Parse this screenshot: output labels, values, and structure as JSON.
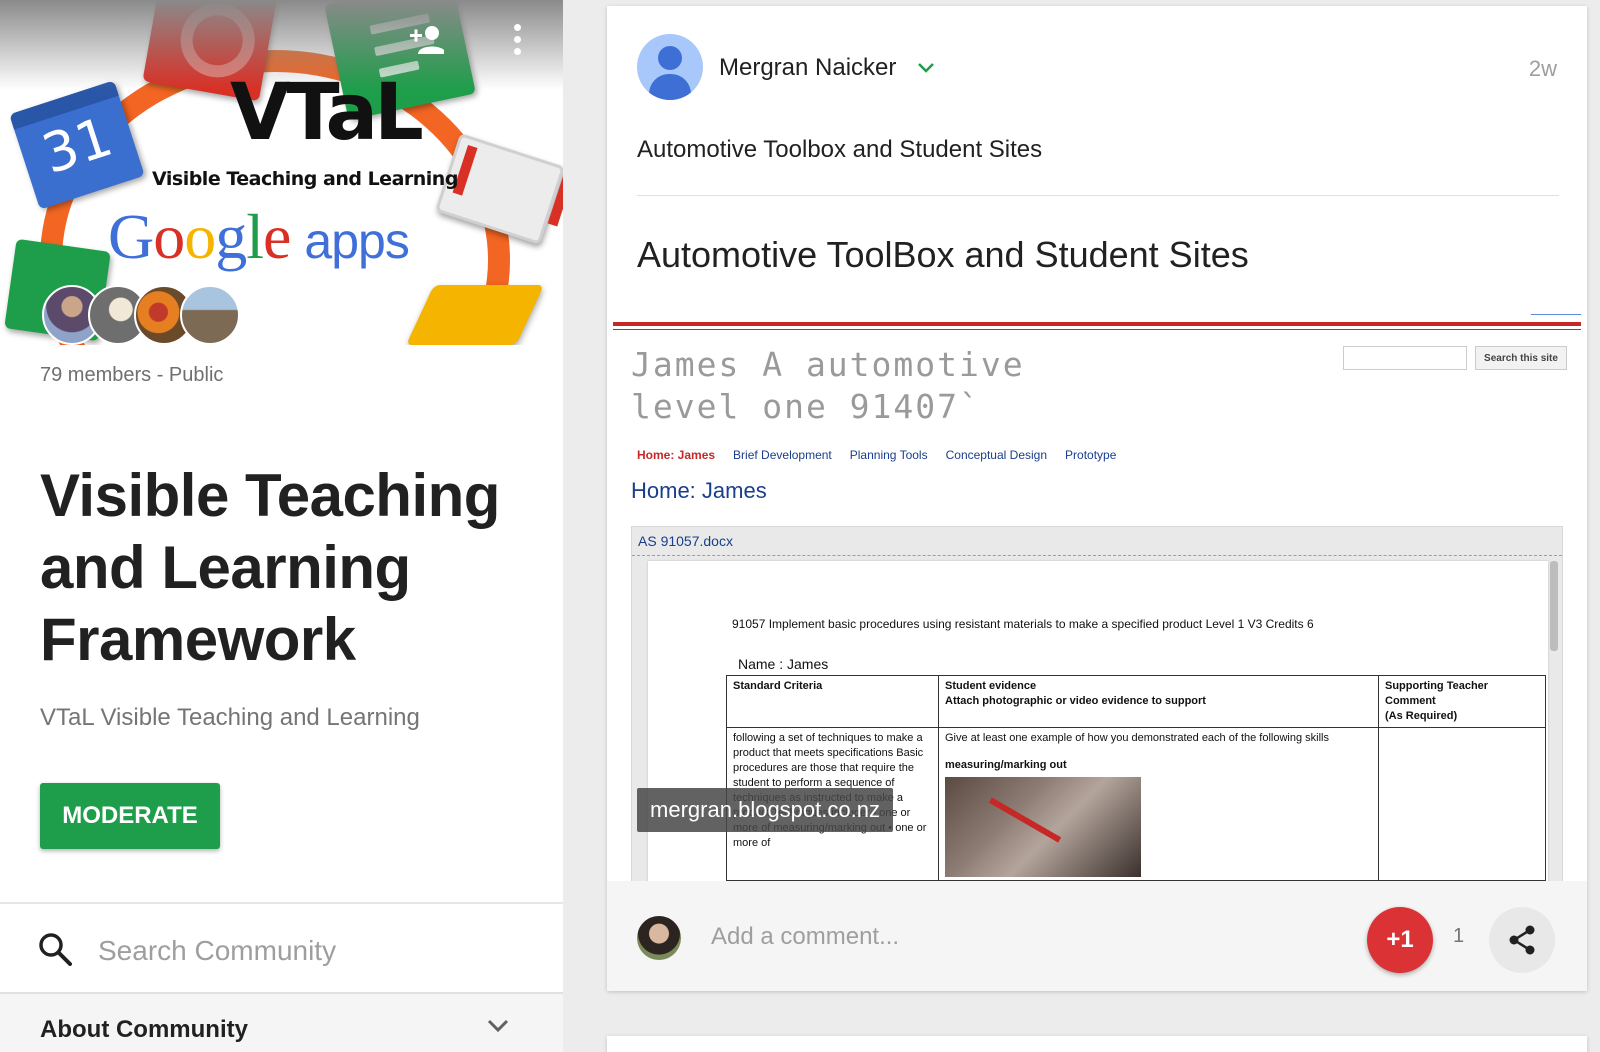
{
  "community": {
    "banner": {
      "logo_text": "VTaL",
      "logo_subtitle": "Visible Teaching and Learning",
      "google_text": "Google",
      "apps_text": "apps",
      "calendar_number": "31"
    },
    "members_text": "79 members - Public",
    "title": "Visible Teaching and Learning Framework",
    "subtitle": "VTaL Visible Teaching and Learning",
    "moderate_label": "MODERATE",
    "search_placeholder": "Search Community",
    "about_label": "About Community"
  },
  "post": {
    "author": "Mergran Naicker",
    "time": "2w",
    "text": "Automotive Toolbox and Student Sites",
    "link_title": "Automotive ToolBox and Student Sites",
    "preview": {
      "site_title_line1": "James A automotive",
      "site_title_line2": "level one 91407`",
      "search_button": "Search this site",
      "nav": [
        "Home: James",
        "Brief Development",
        "Planning Tools",
        "Conceptual Design",
        "Prototype"
      ],
      "heading": "Home: James",
      "doc_name": "AS 91057.docx",
      "doc_line": "91057 Implement basic procedures using resistant materials to make a specified product    Level  1  V3  Credits 6",
      "doc_student": "Name : James",
      "table_headers": [
        "Standard Criteria",
        "Student evidence",
        "Attach photographic or video evidence to support",
        "Supporting Teacher  Comment",
        "(As Required)"
      ],
      "criteria_text": "following a set of techniques to make a product that meets specifications Basic procedures are those that require the student to perform a sequence of techniques as instructed to make a product Techniques include: • one or more of measuring/marking out • one or more of",
      "evidence_intro": "Give at least one example of how you demonstrated each of  the following skills",
      "evidence_item": "measuring/marking out",
      "watermark": "mergran.blogspot.co.nz"
    },
    "comment_placeholder": "Add a comment...",
    "plusone_label": "+1",
    "plusone_count": "1"
  },
  "colors": {
    "moderate": "#1e9e4a",
    "plusone": "#db3236",
    "site_link": "#1a3e8c",
    "site_red": "#c62828"
  }
}
